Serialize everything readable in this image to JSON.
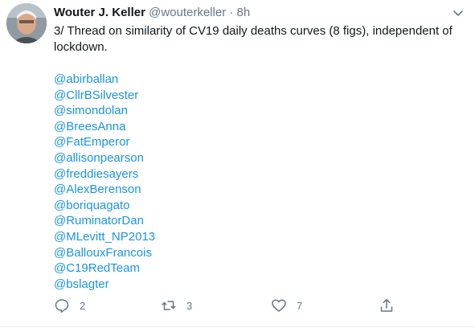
{
  "tweet": {
    "author_name": "Wouter J. Keller",
    "author_handle": "@wouterkeller",
    "separator": "·",
    "time_ago": "8h",
    "text": "3/ Thread on similarity of CV19 daily deaths curves (8 figs), independent of lockdown.",
    "mentions": [
      "@abirballan",
      "@CllrBSilvester",
      "@simondolan",
      "@BreesAnna",
      "@FatEmperor",
      "@allisonpearson",
      "@freddiesayers",
      "@AlexBerenson",
      "@boriquagato",
      "@RuminatorDan",
      "@MLevitt_NP2013",
      "@BallouxFrancois",
      "@C19RedTeam",
      "@bslagter"
    ]
  },
  "actions": {
    "reply_count": "2",
    "retweet_count": "3",
    "like_count": "7"
  },
  "icons": {
    "reply": "reply-icon",
    "retweet": "retweet-icon",
    "like": "heart-icon",
    "share": "share-icon",
    "menu": "chevron-down-icon"
  },
  "colors": {
    "link": "#1b95e0",
    "muted": "#657786",
    "text": "#14171a"
  }
}
